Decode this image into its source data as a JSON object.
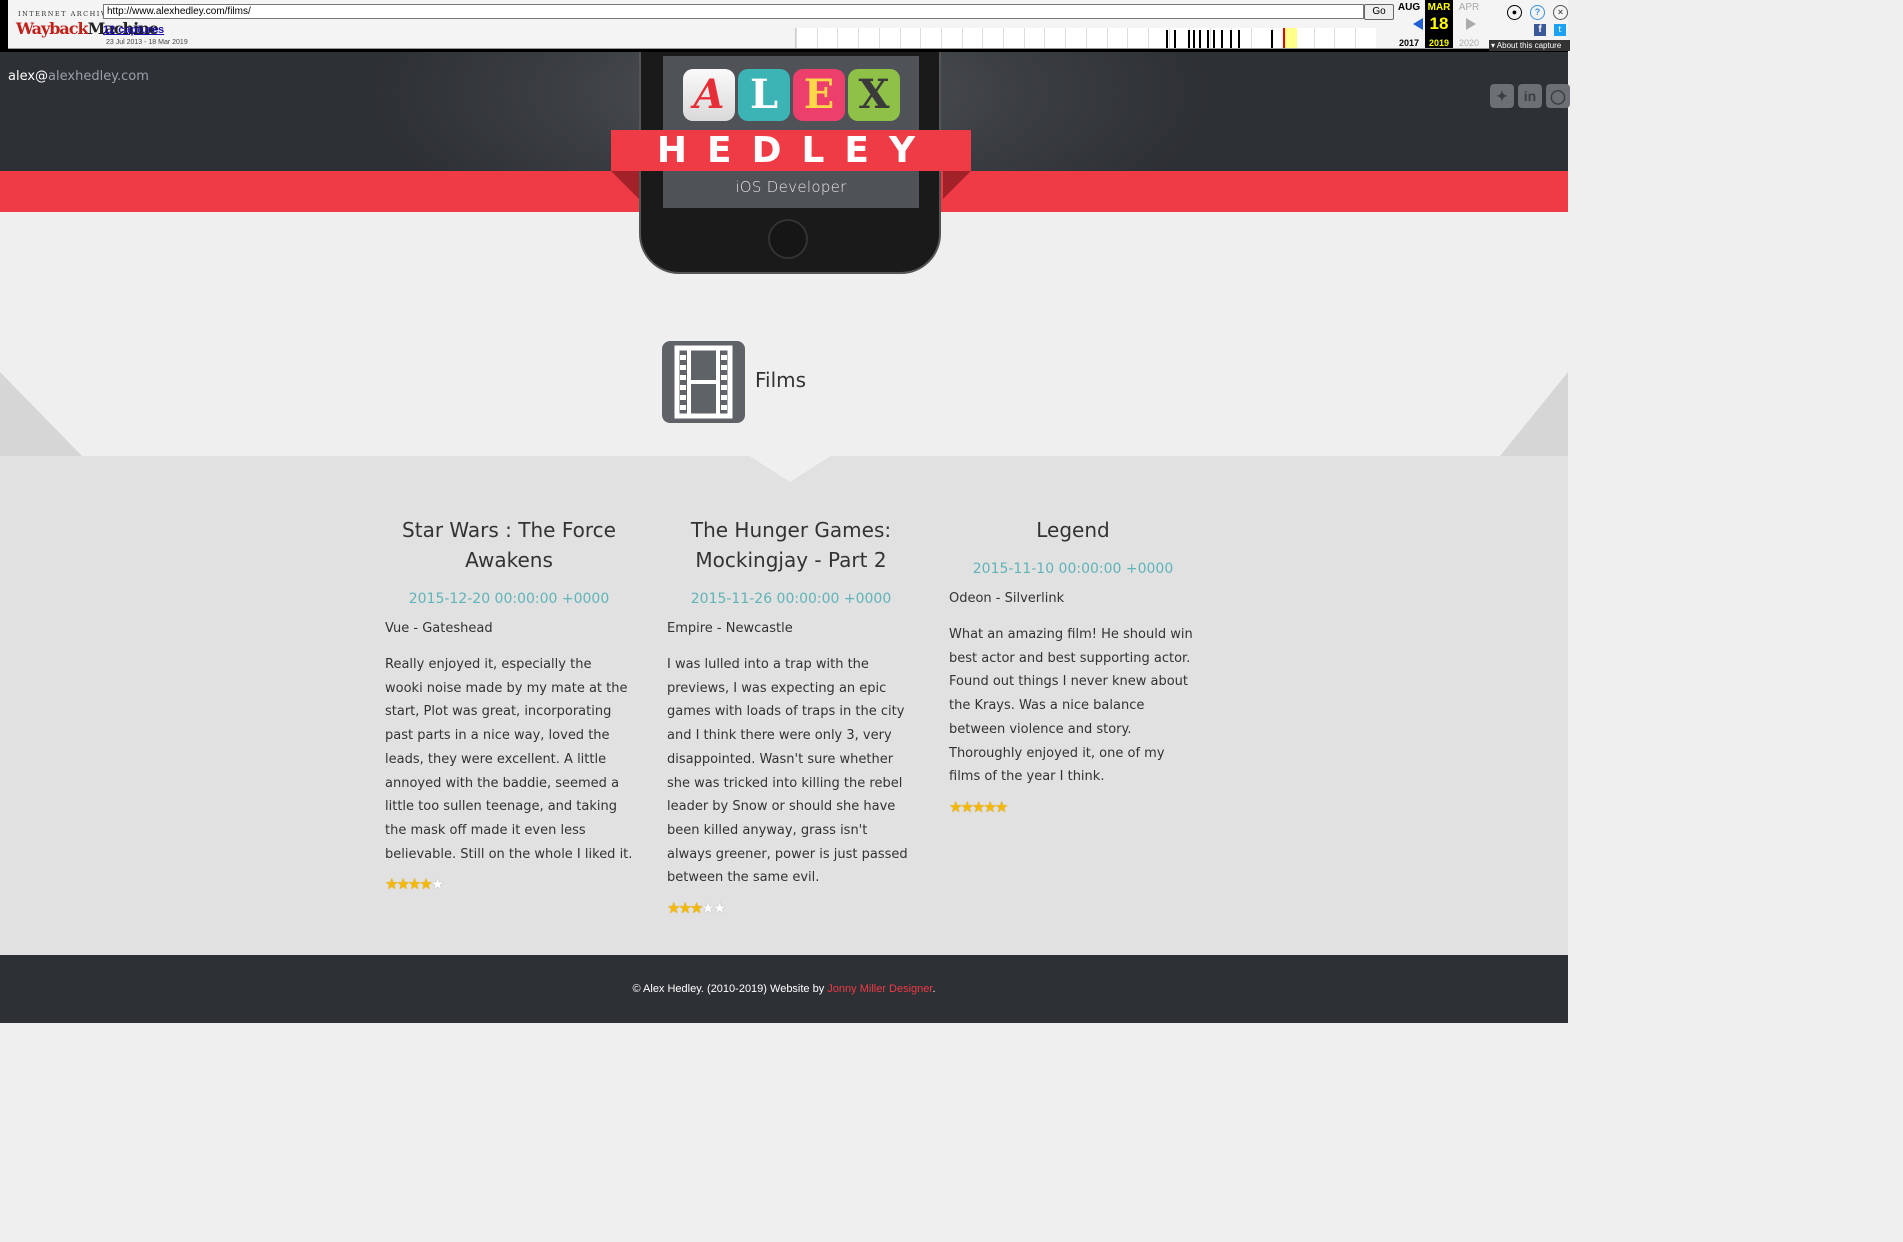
{
  "wayback": {
    "logo_top": "INTERNET ARCHIVE",
    "logo_wayback": "Wayback",
    "logo_machine": "Machine",
    "url": "http://www.alexhedley.com/films/",
    "go_label": "Go",
    "captures": "12 captures",
    "date_range": "23 Jul 2013 - 18 Mar 2019",
    "prev_month": "AUG",
    "prev_year": "2017",
    "cur_month": "MAR",
    "cur_day": "18",
    "cur_year": "2019",
    "next_month": "APR",
    "next_year": "2020",
    "about": "About this capture",
    "user_icon": "?",
    "help_icon": "?",
    "close_icon": "×",
    "fb_icon": "f",
    "tw_icon": "t"
  },
  "header": {
    "email_user": "alex@",
    "email_domain": "alexhedley.com",
    "logo_letters": [
      "A",
      "L",
      "E",
      "X"
    ],
    "name": "HEDLEY",
    "subtitle": "iOS Developer",
    "social": [
      "logo-icon",
      "linkedin-icon",
      "github-icon"
    ]
  },
  "section": {
    "title": "Films",
    "icon": "film-strip-icon"
  },
  "films": [
    {
      "title": "Star Wars : The Force Awakens",
      "date": "2015-12-20 00:00:00 +0000",
      "venue": "Vue - Gateshead",
      "review": "Really enjoyed it, especially the wooki noise made by my mate at the start, Plot was great, incorporating past parts in a nice way, loved the leads, they were excellent. A little annoyed with the baddie, seemed a little too sullen teenage, and taking the mask off made it even less believable. Still on the whole I liked it.",
      "rating": 4
    },
    {
      "title": "The Hunger Games: Mockingjay - Part 2",
      "date": "2015-11-26 00:00:00 +0000",
      "venue": "Empire - Newcastle",
      "review": "I was lulled into a trap with the previews, I was expecting an epic games with loads of traps in the city and I think there were only 3, very disappointed. Wasn't sure whether she was tricked into killing the rebel leader by Snow or should she have been killed anyway, grass isn't always greener, power is just passed between the same evil.",
      "rating": 3
    },
    {
      "title": "Legend",
      "date": "2015-11-10 00:00:00 +0000",
      "venue": "Odeon - Silverlink",
      "review": "What an amazing film! He should win best actor and best supporting actor. Found out things I never knew about the Krays. Was a nice balance between violence and story. Thoroughly enjoyed it, one of my films of the year I think.",
      "rating": 5
    }
  ],
  "footer": {
    "text": "© Alex Hedley. (2010-2019) Website by ",
    "link": "Jonny Miller Designer",
    "suffix": "."
  },
  "colors": {
    "accent_red": "#ef3b46",
    "date_teal": "#5fb4b8",
    "dark": "#2d3035"
  }
}
